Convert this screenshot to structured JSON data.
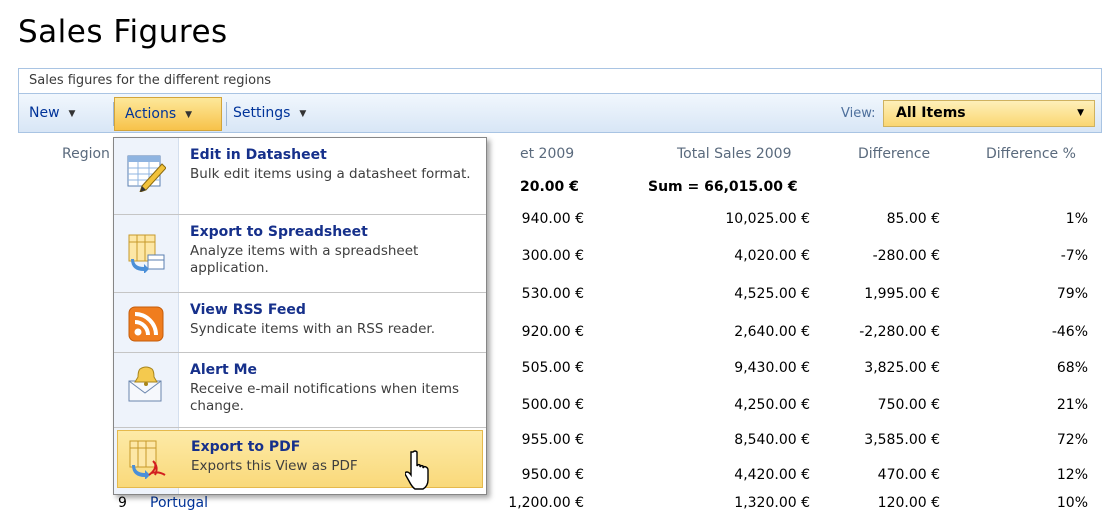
{
  "page": {
    "title": "Sales Figures",
    "description": "Sales figures for the different regions"
  },
  "toolbar": {
    "new_label": "New",
    "actions_label": "Actions",
    "settings_label": "Settings",
    "view_label": "View:",
    "view_value": "All Items"
  },
  "columns": {
    "region": "Region I",
    "budget": "et 2009",
    "total_sales": "Total Sales 2009",
    "difference": "Difference",
    "difference_pct": "Difference %"
  },
  "totals": {
    "budget": "20.00 €",
    "sales": "Sum = 66,015.00 €"
  },
  "rows": [
    {
      "budget": "940.00 €",
      "sales": "10,025.00 €",
      "diff": "85.00 €",
      "pct": "1%"
    },
    {
      "budget": "300.00 €",
      "sales": "4,020.00 €",
      "diff": "-280.00 €",
      "pct": "-7%"
    },
    {
      "budget": "530.00 €",
      "sales": "4,525.00 €",
      "diff": "1,995.00 €",
      "pct": "79%"
    },
    {
      "budget": "920.00 €",
      "sales": "2,640.00 €",
      "diff": "-2,280.00 €",
      "pct": "-46%"
    },
    {
      "budget": "505.00 €",
      "sales": "9,430.00 €",
      "diff": "3,825.00 €",
      "pct": "68%"
    },
    {
      "budget": "500.00 €",
      "sales": "4,250.00 €",
      "diff": "750.00 €",
      "pct": "21%"
    },
    {
      "budget": "955.00 €",
      "sales": "8,540.00 €",
      "diff": "3,585.00 €",
      "pct": "72%"
    },
    {
      "budget": "950.00 €",
      "sales": "4,420.00 €",
      "diff": "470.00 €",
      "pct": "12%"
    },
    {
      "id": "9",
      "region": "Portugal",
      "budget": "1,200.00 €",
      "sales": "1,320.00 €",
      "diff": "120.00 €",
      "pct": "10%"
    }
  ],
  "actions_menu": [
    {
      "title": "Edit in Datasheet",
      "desc": "Bulk edit items using a datasheet format.",
      "icon": "datasheet-icon"
    },
    {
      "title": "Export to Spreadsheet",
      "desc": "Analyze items with a spreadsheet application.",
      "icon": "spreadsheet-icon"
    },
    {
      "title": "View RSS Feed",
      "desc": "Syndicate items with an RSS reader.",
      "icon": "rss-icon"
    },
    {
      "title": "Alert Me",
      "desc": "Receive e-mail notifications when items change.",
      "icon": "alert-icon"
    },
    {
      "title": "Export to PDF",
      "desc": "Exports this View as PDF",
      "icon": "pdf-export-icon"
    }
  ],
  "colors": {
    "accent": "#003399",
    "menu_highlight": "#f9d97a",
    "toolbar_border": "#a9c4e3"
  }
}
